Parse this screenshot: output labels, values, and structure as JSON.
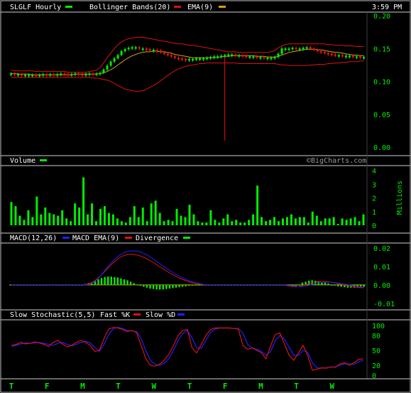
{
  "chart_data": [
    {
      "panel": "price",
      "type": "candlestick",
      "title": "SLGLF Hourly",
      "time": "3:59 PM",
      "legend": [
        {
          "name": "Bollinger Bands(20)",
          "color": "#e01010"
        },
        {
          "name": "EMA(9)",
          "color": "#d4a017"
        }
      ],
      "legend_key_color": "#00ee00",
      "ylim": [
        0.0,
        0.2
      ],
      "y_ticks": [
        "0.20",
        "0.15",
        "0.10",
        "0.05",
        "0.00"
      ],
      "y_tick_values": [
        0.2,
        0.15,
        0.1,
        0.05,
        0.0
      ],
      "close": [
        0.112,
        0.11,
        0.111,
        0.11,
        0.11,
        0.11,
        0.11,
        0.109,
        0.11,
        0.111,
        0.11,
        0.111,
        0.11,
        0.111,
        0.112,
        0.111,
        0.11,
        0.111,
        0.112,
        0.111,
        0.11,
        0.111,
        0.112,
        0.111,
        0.112,
        0.113,
        0.118,
        0.124,
        0.13,
        0.135,
        0.14,
        0.146,
        0.149,
        0.151,
        0.152,
        0.152,
        0.15,
        0.15,
        0.149,
        0.148,
        0.148,
        0.147,
        0.144,
        0.142,
        0.14,
        0.138,
        0.136,
        0.135,
        0.134,
        0.133,
        0.134,
        0.134,
        0.135,
        0.135,
        0.135,
        0.136,
        0.137,
        0.138,
        0.138,
        0.139,
        0.14,
        0.141,
        0.141,
        0.14,
        0.14,
        0.139,
        0.138,
        0.138,
        0.138,
        0.137,
        0.137,
        0.136,
        0.136,
        0.136,
        0.137,
        0.142,
        0.15,
        0.15,
        0.15,
        0.151,
        0.15,
        0.15,
        0.151,
        0.152,
        0.15,
        0.148,
        0.146,
        0.145,
        0.143,
        0.142,
        0.141,
        0.14,
        0.14,
        0.139,
        0.139,
        0.139,
        0.138,
        0.138,
        0.137,
        0.137
      ],
      "bb_upper": [
        0.117,
        0.116,
        0.116,
        0.116,
        0.116,
        0.116,
        0.116,
        0.115,
        0.115,
        0.115,
        0.115,
        0.115,
        0.115,
        0.115,
        0.115,
        0.115,
        0.114,
        0.114,
        0.114,
        0.114,
        0.114,
        0.114,
        0.115,
        0.116,
        0.117,
        0.121,
        0.128,
        0.136,
        0.143,
        0.15,
        0.156,
        0.16,
        0.163,
        0.165,
        0.166,
        0.167,
        0.167,
        0.167,
        0.166,
        0.165,
        0.164,
        0.163,
        0.162,
        0.161,
        0.16,
        0.159,
        0.158,
        0.157,
        0.157,
        0.156,
        0.155,
        0.155,
        0.154,
        0.153,
        0.152,
        0.151,
        0.15,
        0.149,
        0.148,
        0.147,
        0.146,
        0.145,
        0.145,
        0.145,
        0.144,
        0.144,
        0.144,
        0.144,
        0.144,
        0.144,
        0.144,
        0.144,
        0.144,
        0.145,
        0.147,
        0.151,
        0.154,
        0.156,
        0.157,
        0.157,
        0.157,
        0.157,
        0.157,
        0.157,
        0.157,
        0.157,
        0.157,
        0.157,
        0.157,
        0.156,
        0.156,
        0.155,
        0.155,
        0.155,
        0.154,
        0.154,
        0.154,
        0.153,
        0.153,
        0.153
      ],
      "bb_lower": [
        0.106,
        0.106,
        0.106,
        0.106,
        0.106,
        0.106,
        0.106,
        0.106,
        0.106,
        0.106,
        0.106,
        0.106,
        0.106,
        0.106,
        0.106,
        0.106,
        0.106,
        0.106,
        0.106,
        0.106,
        0.106,
        0.106,
        0.106,
        0.105,
        0.105,
        0.104,
        0.103,
        0.102,
        0.1,
        0.097,
        0.094,
        0.091,
        0.088,
        0.087,
        0.086,
        0.085,
        0.085,
        0.086,
        0.088,
        0.091,
        0.094,
        0.097,
        0.101,
        0.105,
        0.109,
        0.113,
        0.116,
        0.119,
        0.121,
        0.123,
        0.124,
        0.125,
        0.126,
        0.127,
        0.127,
        0.128,
        0.128,
        0.128,
        0.128,
        0.128,
        0.128,
        0.128,
        0.128,
        0.128,
        0.127,
        0.127,
        0.127,
        0.127,
        0.127,
        0.127,
        0.127,
        0.127,
        0.127,
        0.127,
        0.127,
        0.126,
        0.125,
        0.125,
        0.124,
        0.124,
        0.124,
        0.124,
        0.124,
        0.124,
        0.125,
        0.125,
        0.126,
        0.126,
        0.126,
        0.127,
        0.127,
        0.128,
        0.128,
        0.129,
        0.129,
        0.13,
        0.13,
        0.13,
        0.131,
        0.131
      ],
      "ema": [
        0.112,
        0.112,
        0.111,
        0.111,
        0.111,
        0.111,
        0.11,
        0.11,
        0.11,
        0.11,
        0.11,
        0.11,
        0.11,
        0.11,
        0.11,
        0.11,
        0.11,
        0.11,
        0.111,
        0.111,
        0.111,
        0.111,
        0.111,
        0.111,
        0.111,
        0.112,
        0.113,
        0.115,
        0.118,
        0.121,
        0.125,
        0.129,
        0.133,
        0.136,
        0.139,
        0.141,
        0.143,
        0.144,
        0.145,
        0.145,
        0.146,
        0.146,
        0.145,
        0.145,
        0.144,
        0.143,
        0.141,
        0.14,
        0.139,
        0.138,
        0.137,
        0.136,
        0.136,
        0.136,
        0.136,
        0.136,
        0.136,
        0.136,
        0.137,
        0.137,
        0.138,
        0.138,
        0.139,
        0.139,
        0.139,
        0.139,
        0.139,
        0.139,
        0.139,
        0.138,
        0.138,
        0.138,
        0.137,
        0.137,
        0.137,
        0.138,
        0.14,
        0.142,
        0.144,
        0.145,
        0.146,
        0.147,
        0.148,
        0.149,
        0.149,
        0.149,
        0.148,
        0.148,
        0.147,
        0.146,
        0.145,
        0.144,
        0.144,
        0.143,
        0.142,
        0.141,
        0.14,
        0.14,
        0.139,
        0.139
      ],
      "spike_low": 0.01
    },
    {
      "panel": "volume",
      "type": "bar",
      "title": "Volume",
      "watermark": "©BigCharts.com",
      "ylabel": "Millions",
      "ylim": [
        0,
        4
      ],
      "y_ticks": [
        "4",
        "3",
        "2",
        "1",
        "0"
      ],
      "y_tick_values": [
        4,
        3,
        2,
        1,
        0
      ],
      "values": [
        1.7,
        1.4,
        0.7,
        0.4,
        1.1,
        0.6,
        2.1,
        0.8,
        1.3,
        0.9,
        0.8,
        0.7,
        1.1,
        0.5,
        0.3,
        1.6,
        1.3,
        3.5,
        0.8,
        1.6,
        0.3,
        1.2,
        1.4,
        0.9,
        0.8,
        0.5,
        0.3,
        0.2,
        0.6,
        1.4,
        0.6,
        1.3,
        0.3,
        1.6,
        1.8,
        0.9,
        0.3,
        0.4,
        0.3,
        1.2,
        0.7,
        0.6,
        1.5,
        0.8,
        0.3,
        0.2,
        0.2,
        1.1,
        0.4,
        0.2,
        0.5,
        0.8,
        0.3,
        0.4,
        0.2,
        0.2,
        0.4,
        0.8,
        2.9,
        0.6,
        0.3,
        0.4,
        0.6,
        0.3,
        0.5,
        0.6,
        0.8,
        0.5,
        0.6,
        0.6,
        0.2,
        1.0,
        0.7,
        0.3,
        0.5,
        0.5,
        0.6,
        0.1,
        0.5,
        0.4,
        0.5,
        0.6,
        0.3,
        0.8
      ]
    },
    {
      "panel": "macd",
      "type": "line",
      "title": "MACD(12,26)",
      "legend": [
        {
          "name": "MACD EMA(9)",
          "color": "#2020ff"
        },
        {
          "name": "Divergence",
          "color": "#e01010"
        }
      ],
      "legend_key_color": "#00ee00",
      "ylim": [
        -0.012,
        0.02
      ],
      "y_ticks": [
        "0.02",
        "0.01",
        "0.00",
        "-0.01"
      ],
      "y_tick_values": [
        0.02,
        0.01,
        0.0,
        -0.01
      ],
      "macd": [
        0.0,
        0.0,
        0.0,
        0.0,
        0.0,
        0.0,
        0.0,
        0.0,
        0.0,
        0.0,
        0.0,
        0.0,
        0.0,
        0.0,
        0.0,
        0.0,
        0.0,
        0.0,
        0.0,
        0.0,
        0.0,
        0.0,
        0.0,
        0.0002,
        0.0006,
        0.0013,
        0.0024,
        0.0038,
        0.0055,
        0.0073,
        0.0092,
        0.011,
        0.0126,
        0.014,
        0.0152,
        0.016,
        0.0164,
        0.0166,
        0.0165,
        0.0162,
        0.0157,
        0.015,
        0.0141,
        0.0131,
        0.0121,
        0.011,
        0.0098,
        0.0087,
        0.0076,
        0.0065,
        0.0055,
        0.0046,
        0.0037,
        0.003,
        0.0023,
        0.0017,
        0.0012,
        0.0008,
        0.0004,
        0.0001,
        0.0,
        0.0,
        0.0,
        0.0,
        0.0,
        0.0,
        0.0,
        0.0,
        0.0,
        0.0,
        0.0,
        0.0,
        0.0,
        0.0,
        0.0,
        0.0,
        0.0,
        0.0,
        0.0,
        0.0,
        0.0,
        0.0,
        0.0,
        0.0,
        0.0,
        -0.0003,
        -0.0006,
        -0.0009,
        -0.001,
        -0.0008,
        -0.0004,
        0.0001,
        0.0007,
        0.0012,
        0.0016,
        0.0018,
        0.0019,
        0.0019,
        0.0017,
        0.0014,
        0.0011,
        0.0007,
        0.0003,
        -0.0001,
        -0.0005,
        -0.0008,
        -0.0011,
        -0.0013,
        -0.0015,
        -0.0016
      ],
      "signal": [
        0.0,
        0.0,
        0.0,
        0.0,
        0.0,
        0.0,
        0.0,
        0.0,
        0.0,
        0.0,
        0.0,
        0.0,
        0.0,
        0.0,
        0.0,
        0.0,
        0.0,
        0.0,
        0.0,
        0.0,
        0.0,
        0.0,
        0.0,
        0.0,
        0.0002,
        0.0008,
        0.0019,
        0.0035,
        0.0055,
        0.0078,
        0.01,
        0.012,
        0.0138,
        0.0153,
        0.0165,
        0.0175,
        0.0181,
        0.0184,
        0.0185,
        0.0183,
        0.0179,
        0.0172,
        0.0163,
        0.0152,
        0.014,
        0.0128,
        0.0115,
        0.0102,
        0.009,
        0.0078,
        0.0067,
        0.0057,
        0.0047,
        0.0038,
        0.003,
        0.0023,
        0.0017,
        0.0012,
        0.0008,
        0.0004,
        0.0001,
        0.0,
        0.0,
        0.0,
        0.0,
        0.0,
        0.0,
        0.0,
        0.0,
        0.0,
        0.0,
        0.0,
        0.0,
        0.0,
        0.0,
        0.0,
        0.0,
        0.0,
        0.0,
        0.0,
        0.0,
        0.0,
        0.0,
        0.0,
        0.0,
        -0.0001,
        -0.0003,
        -0.0006,
        -0.0008,
        -0.0009,
        -0.0009,
        -0.0006,
        -0.0002,
        0.0002,
        0.0007,
        0.001,
        0.0013,
        0.0014,
        0.0015,
        0.0014,
        0.0012,
        0.001,
        0.0007,
        0.0004,
        0.0001,
        -0.0002,
        -0.0005,
        -0.0008,
        -0.001,
        -0.0012
      ],
      "divergence": [
        0.0,
        0.0,
        0.0,
        0.0,
        0.0,
        0.0,
        0.0,
        0.0,
        0.0,
        0.0,
        0.0,
        0.0,
        0.0,
        0.0,
        0.0,
        0.0,
        0.0,
        0.0,
        0.0,
        0.0,
        0.0,
        0.0,
        0.0,
        0.0002,
        0.0004,
        0.0006,
        0.0009,
        0.0012,
        0.0015,
        0.0017,
        0.0018,
        0.0018,
        0.0017,
        0.0016,
        0.0014,
        0.0012,
        0.001,
        0.0007,
        0.0004,
        0.0001,
        -0.0002,
        -0.0004,
        -0.0006,
        -0.0008,
        -0.0009,
        -0.001,
        -0.001,
        -0.001,
        -0.0009,
        -0.0008,
        -0.0007,
        -0.0006,
        -0.0005,
        -0.0004,
        -0.0003,
        -0.0002,
        -0.0001,
        0.0,
        0.0,
        0.0,
        0.0,
        0.0,
        0.0,
        0.0,
        0.0,
        0.0,
        0.0,
        0.0,
        0.0,
        0.0,
        0.0,
        0.0,
        0.0,
        0.0,
        0.0,
        0.0,
        0.0,
        0.0,
        0.0,
        0.0,
        0.0,
        0.0,
        0.0,
        0.0,
        0.0,
        -0.0002,
        -0.0003,
        -0.0003,
        -0.0002,
        0.0001,
        0.0005,
        0.0007,
        0.0009,
        0.001,
        0.0009,
        0.0008,
        0.0006,
        0.0005,
        0.0003,
        0.0,
        -0.0001,
        -0.0003,
        -0.0004,
        -0.0005,
        -0.0006,
        -0.0006,
        -0.0006,
        -0.0005,
        -0.0005,
        -0.0004
      ]
    },
    {
      "panel": "stochastic",
      "type": "line",
      "title": "Slow Stochastic(5,5)",
      "legend": [
        {
          "name": "Fast %K",
          "color": "#e01010"
        },
        {
          "name": "Slow %D",
          "color": "#2020ff"
        }
      ],
      "ylim": [
        0,
        100
      ],
      "y_ticks": [
        "100",
        "80",
        "50",
        "20",
        "0"
      ],
      "y_tick_values": [
        100,
        80,
        50,
        20,
        0
      ],
      "fast_k": [
        60,
        62,
        66,
        63,
        64,
        67,
        65,
        62,
        58,
        66,
        70,
        63,
        57,
        60,
        66,
        70,
        66,
        60,
        48,
        50,
        74,
        93,
        96,
        95,
        92,
        88,
        90,
        86,
        60,
        34,
        20,
        18,
        22,
        30,
        42,
        60,
        80,
        90,
        92,
        55,
        45,
        62,
        80,
        92,
        95,
        95,
        95,
        95,
        94,
        93,
        60,
        52,
        55,
        50,
        45,
        33,
        60,
        82,
        85,
        62,
        40,
        30,
        45,
        60,
        40,
        10,
        12,
        15,
        14,
        17,
        16,
        23,
        25,
        20,
        25,
        32,
        33
      ],
      "slow_d": [
        58,
        60,
        63,
        65,
        64,
        65,
        66,
        64,
        62,
        60,
        64,
        66,
        62,
        59,
        62,
        66,
        68,
        65,
        56,
        48,
        62,
        82,
        94,
        96,
        94,
        90,
        89,
        88,
        74,
        50,
        30,
        22,
        20,
        24,
        34,
        50,
        70,
        84,
        90,
        75,
        55,
        54,
        70,
        86,
        93,
        95,
        95,
        95,
        94,
        94,
        85,
        62,
        55,
        52,
        48,
        40,
        48,
        70,
        80,
        72,
        56,
        40,
        40,
        50,
        46,
        25,
        15,
        14,
        15,
        16,
        17,
        20,
        23,
        23,
        22,
        27,
        30
      ]
    }
  ],
  "x_axis_labels": [
    "T",
    "F",
    "M",
    "T",
    "W",
    "T",
    "F",
    "M",
    "T",
    "W"
  ],
  "x_axis_label_positions": [
    0.0,
    0.1,
    0.2,
    0.3,
    0.4,
    0.5,
    0.6,
    0.7,
    0.8,
    0.9
  ],
  "colors": {
    "background": "#000000",
    "frame": "#c0c0c0",
    "panel_border": "#d0d0d0",
    "text": "#ffffff",
    "axis_text": "#00ee00",
    "price_up": "#00ee00",
    "price_down": "#ee1111",
    "bollinger": "#e01010",
    "ema": "#d4a017",
    "volume": "#00ee00",
    "macd": "#e01010",
    "signal": "#2020ff",
    "divergence": "#00ee00",
    "zero_line": "#d4a017",
    "fast_k": "#e01010",
    "slow_d": "#2020ff"
  }
}
